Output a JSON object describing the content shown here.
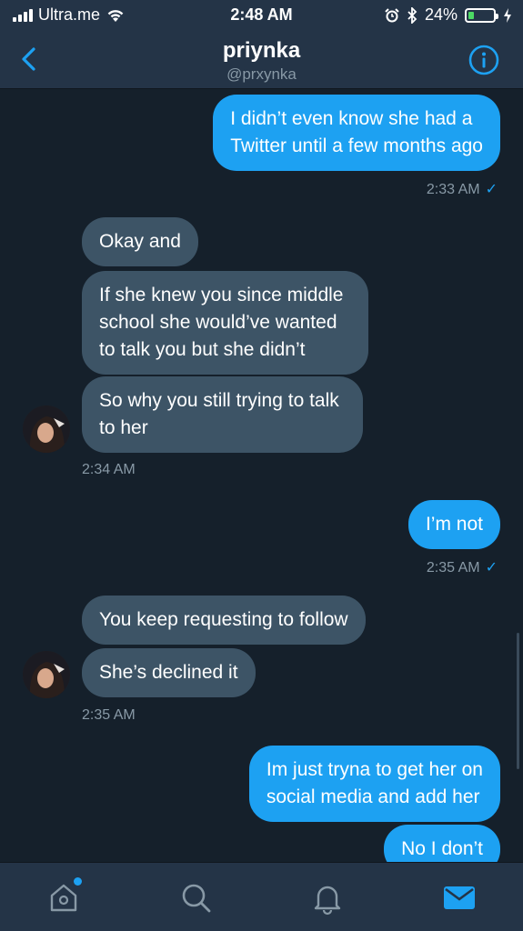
{
  "status_bar": {
    "carrier": "Ultra.me",
    "time": "2:48 AM",
    "battery_text": "24%",
    "battery_level": 0.24,
    "icons": [
      "signal-icon",
      "wifi-icon",
      "alarm-icon",
      "bluetooth-icon",
      "battery-icon",
      "charging-icon"
    ]
  },
  "header": {
    "name": "priynka",
    "handle": "@prxynka",
    "back_icon": "chevron-left-icon",
    "info_icon": "info-icon"
  },
  "messages": [
    {
      "direction": "out",
      "lines": [
        "I didn’t even know she had a",
        "Twitter until a few months ago"
      ]
    },
    {
      "direction": "out-time",
      "time": "2:33 AM"
    },
    {
      "direction": "in",
      "lines": [
        "Okay and"
      ]
    },
    {
      "direction": "in",
      "lines": [
        "If she knew you since middle",
        "school she would’ve wanted",
        "to talk you but she didn’t"
      ]
    },
    {
      "direction": "in",
      "lines": [
        "So why you still trying to talk",
        "to her"
      ]
    },
    {
      "direction": "in-time",
      "time": "2:34 AM"
    },
    {
      "direction": "out",
      "lines": [
        "I’m not"
      ]
    },
    {
      "direction": "out-time",
      "time": "2:35 AM"
    },
    {
      "direction": "in",
      "lines": [
        "You keep requesting to follow"
      ]
    },
    {
      "direction": "in",
      "lines": [
        "She’s declined it"
      ]
    },
    {
      "direction": "in-time",
      "time": "2:35 AM"
    },
    {
      "direction": "out",
      "lines": [
        "Im just tryna to get her on",
        "social media and add her"
      ]
    },
    {
      "direction": "out",
      "lines": [
        "No I don’t"
      ]
    }
  ],
  "read_check": "✓",
  "tabbar": {
    "tabs": [
      "home-icon",
      "search-icon",
      "notifications-icon",
      "messages-icon"
    ],
    "active": "messages-icon"
  },
  "colors": {
    "background": "#15202b",
    "bar": "#243447",
    "outgoing_bubble": "#1da1f2",
    "incoming_bubble": "#3d5466",
    "muted_text": "#8899a6",
    "accent": "#1da1f2"
  }
}
